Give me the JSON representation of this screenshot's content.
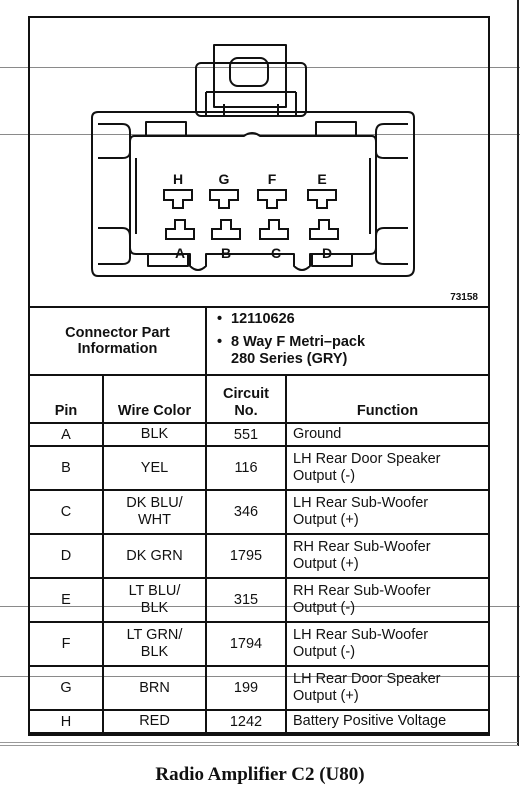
{
  "diagram": {
    "figure_number": "73158",
    "pin_labels_top": [
      "H",
      "G",
      "F",
      "E"
    ],
    "pin_labels_bottom": [
      "A",
      "B",
      "C",
      "D"
    ]
  },
  "connector_info": {
    "label_line1": "Connector Part",
    "label_line2": "Information",
    "part_number": "12110626",
    "description_line1": "8 Way F Metri–pack",
    "description_line2": "280 Series (GRY)"
  },
  "table": {
    "headers": {
      "pin": "Pin",
      "wire_color": "Wire Color",
      "circuit_line1": "Circuit",
      "circuit_line2": "No.",
      "function": "Function"
    },
    "rows": [
      {
        "pin": "A",
        "wire1": "BLK",
        "wire2": "",
        "circuit": "551",
        "fn1": "Ground",
        "fn2": ""
      },
      {
        "pin": "B",
        "wire1": "YEL",
        "wire2": "",
        "circuit": "116",
        "fn1": "LH Rear Door Speaker",
        "fn2": "Output (-)"
      },
      {
        "pin": "C",
        "wire1": "DK BLU/",
        "wire2": "WHT",
        "circuit": "346",
        "fn1": "LH Rear Sub-Woofer",
        "fn2": "Output (+)"
      },
      {
        "pin": "D",
        "wire1": "DK GRN",
        "wire2": "",
        "circuit": "1795",
        "fn1": "RH Rear Sub-Woofer",
        "fn2": "Output (+)"
      },
      {
        "pin": "E",
        "wire1": "LT BLU/",
        "wire2": "BLK",
        "circuit": "315",
        "fn1": "RH Rear Sub-Woofer",
        "fn2": "Output (-)"
      },
      {
        "pin": "F",
        "wire1": "LT GRN/",
        "wire2": "BLK",
        "circuit": "1794",
        "fn1": "LH Rear Sub-Woofer",
        "fn2": "Output (-)"
      },
      {
        "pin": "G",
        "wire1": "BRN",
        "wire2": "",
        "circuit": "199",
        "fn1": "LH Rear Door Speaker",
        "fn2": "Output (+)"
      },
      {
        "pin": "H",
        "wire1": "RED",
        "wire2": "",
        "circuit": "1242",
        "fn1": "Battery Positive Voltage",
        "fn2": ""
      }
    ]
  },
  "caption": "Radio Amplifier C2 (U80)"
}
